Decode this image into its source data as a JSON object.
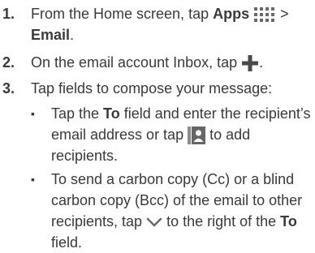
{
  "steps": [
    {
      "num": "1.",
      "pre": "From the Home screen, tap ",
      "bold1": "Apps",
      "mid": " > ",
      "bold2": "Email",
      "post": "."
    },
    {
      "num": "2.",
      "pre": "On the email account Inbox, tap ",
      "post": "."
    },
    {
      "num": "3.",
      "text": "Tap fields to compose your message:"
    }
  ],
  "bullets": [
    {
      "pre": "Tap the ",
      "bold": "To",
      "mid": " field and enter the recipient’s email address or tap ",
      "post": " to add recipients."
    },
    {
      "pre": "To send a carbon copy (Cc) or a blind carbon copy (Bcc) of the email to other recipients, tap ",
      "mid": " to the right of the ",
      "bold": "To",
      "post": " field."
    }
  ],
  "icons": {
    "apps": "apps-grid-icon",
    "compose": "plus-icon",
    "contacts": "contact-card-icon",
    "expand": "chevron-down-icon"
  },
  "colors": {
    "text": "#3a3a3a",
    "icon": "#5a5a5a"
  }
}
